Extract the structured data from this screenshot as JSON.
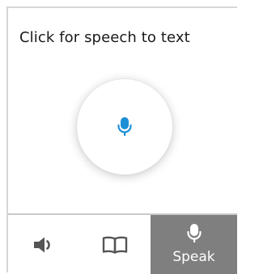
{
  "panel": {
    "title": "Click for speech to text",
    "mic_button_icon": "microphone-icon",
    "accent_color": "#1e8fd6"
  },
  "toolbar": {
    "items": [
      {
        "icon": "speaker-icon",
        "label": ""
      },
      {
        "icon": "book-icon",
        "label": ""
      },
      {
        "icon": "microphone-icon",
        "label": "Speak",
        "active": true
      }
    ],
    "active_background": "#7f7f7f"
  }
}
